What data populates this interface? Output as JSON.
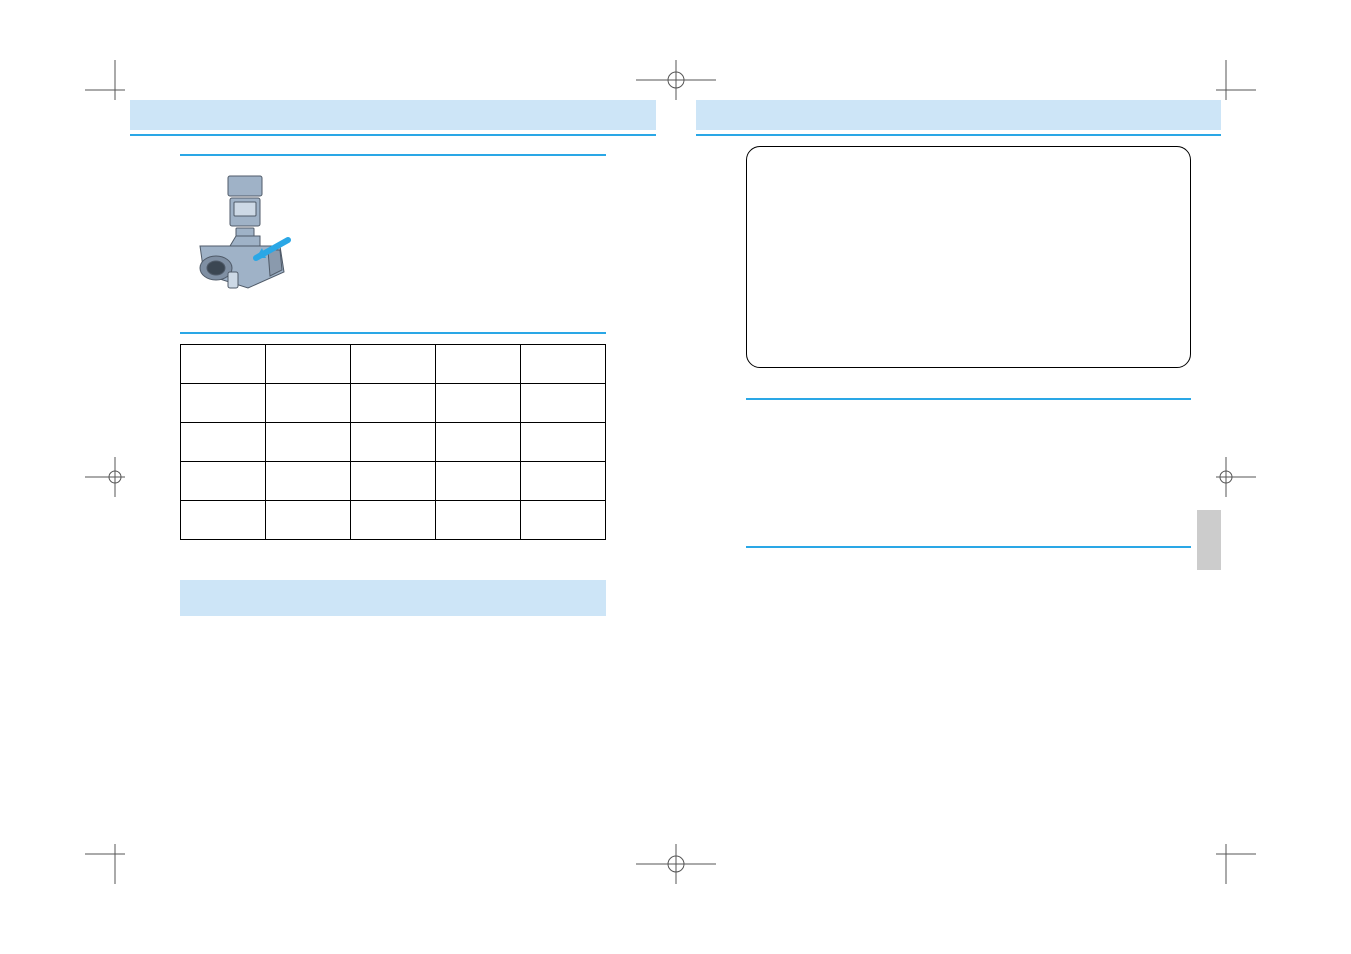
{
  "left_page": {
    "table": {
      "headers": [
        "",
        "",
        "",
        "",
        ""
      ],
      "rows": [
        [
          "",
          "",
          "",
          "",
          ""
        ],
        [
          "",
          "",
          "",
          "",
          ""
        ],
        [
          "",
          "",
          "",
          "",
          ""
        ],
        [
          "",
          "",
          "",
          "",
          ""
        ]
      ]
    }
  },
  "right_page": {}
}
